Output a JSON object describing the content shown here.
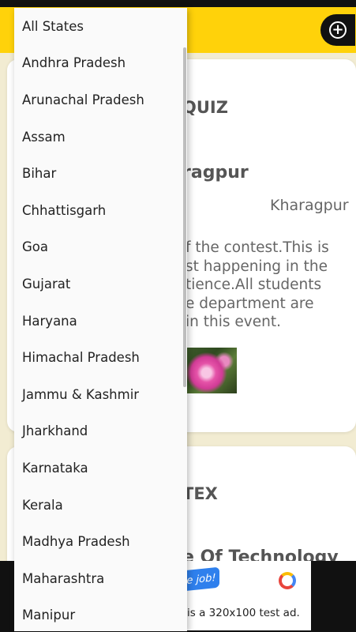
{
  "header": {
    "add_icon": "plus-circle-icon",
    "accent": "#ffd20a"
  },
  "cards": [
    {
      "title": "QUIZ",
      "college": "ragpur",
      "location": "Kharagpur",
      "description_lines": [
        "f the contest.This is",
        "st happening in the",
        "tience.All students",
        "e department are",
        "in this event."
      ]
    },
    {
      "title": "TEX",
      "subtitle": "e Of Technology"
    }
  ],
  "ad": {
    "chip_text": "e job!",
    "text": "is a 320x100 test ad."
  },
  "dropdown": {
    "options": [
      "All States",
      "Andhra Pradesh",
      "Arunachal Pradesh",
      "Assam",
      "Bihar",
      "Chhattisgarh",
      "Goa",
      "Gujarat",
      "Haryana",
      "Himachal Pradesh",
      "Jammu & Kashmir",
      "Jharkhand",
      "Karnataka",
      "Kerala",
      "Madhya Pradesh",
      "Maharashtra",
      "Manipur"
    ]
  }
}
